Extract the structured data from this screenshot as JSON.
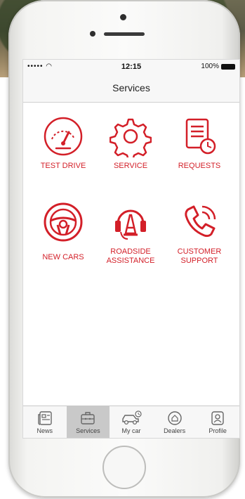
{
  "status_bar": {
    "signal": "••••• ",
    "wifi": "wifi-icon",
    "time": "12:15",
    "battery_text": "100%",
    "battery_icon": "battery-icon"
  },
  "nav": {
    "title": "Services"
  },
  "accent_color": "#d31f28",
  "tiles": [
    {
      "label": "TEST DRIVE",
      "icon": "speedometer-icon"
    },
    {
      "label": "SERVICE",
      "icon": "gear-icon"
    },
    {
      "label": "REQUESTS",
      "icon": "document-clock-icon"
    },
    {
      "label": "NEW CARS",
      "icon": "steering-wheel-icon"
    },
    {
      "label": "ROADSIDE\nASSISTANCE",
      "icon": "roadside-cone-icon"
    },
    {
      "label": "CUSTOMER\nSUPPORT",
      "icon": "phone-call-icon"
    }
  ],
  "tabbar": {
    "items": [
      {
        "label": "News",
        "icon": "newspaper-icon"
      },
      {
        "label": "Services",
        "icon": "briefcase-icon",
        "active": true
      },
      {
        "label": "My car",
        "icon": "car-clock-icon"
      },
      {
        "label": "Dealers",
        "icon": "location-pin-icon"
      },
      {
        "label": "Profile",
        "icon": "person-icon"
      }
    ]
  }
}
